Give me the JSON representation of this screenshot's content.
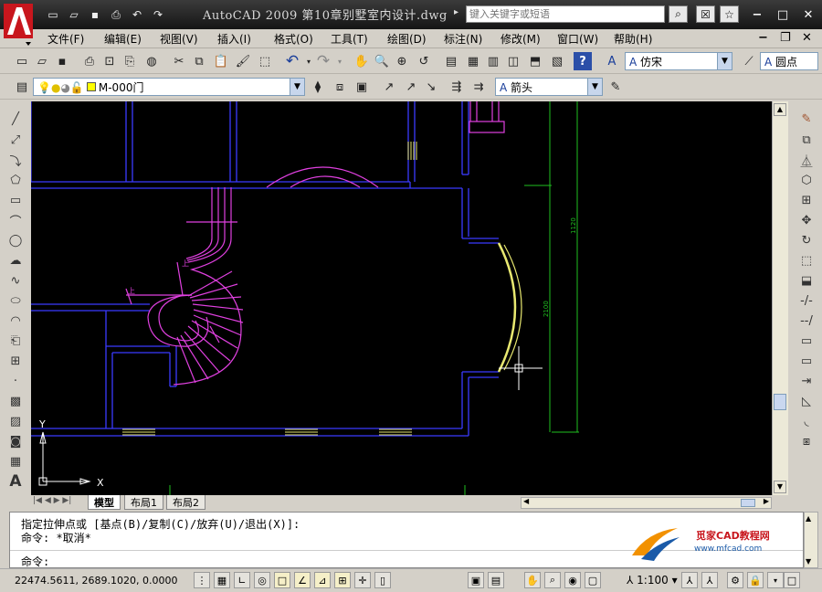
{
  "app": {
    "title": "AutoCAD 2009  第10章别墅室内设计.dwg",
    "search_placeholder": "键入关键字或短语"
  },
  "menu": [
    "文件(F)",
    "编辑(E)",
    "视图(V)",
    "插入(I)",
    "格式(O)",
    "工具(T)",
    "绘图(D)",
    "标注(N)",
    "修改(M)",
    "窗口(W)",
    "帮助(H)"
  ],
  "toolbar": {
    "text_style": "仿宋",
    "dim_style": "圆点",
    "layer": "M-000门",
    "leader_style": "箭头"
  },
  "drawing": {
    "dim_top": "1120",
    "dim_mid": "2100",
    "ucs_y": "Y",
    "ucs_x": "X",
    "stair_up1": "上",
    "stair_up2": "上"
  },
  "tabs": {
    "model": "模型",
    "layout1": "布局1",
    "layout2": "布局2"
  },
  "command": {
    "line1": "指定拉伸点或 [基点(B)/复制(C)/放弃(U)/退出(X)]:",
    "line2": "命令: *取消*",
    "prompt": "命令:"
  },
  "watermark": {
    "name": "觅家CAD教程网",
    "url": "www.mfcad.com"
  },
  "status": {
    "coords": "22474.5611, 2689.1020, 0.0000",
    "scale": "1:100"
  },
  "colors": {
    "canvas": "#000000",
    "wall": "#3a3aff",
    "stair": "#e040e0",
    "dim": "#20c020",
    "selected": "#e8e870"
  }
}
